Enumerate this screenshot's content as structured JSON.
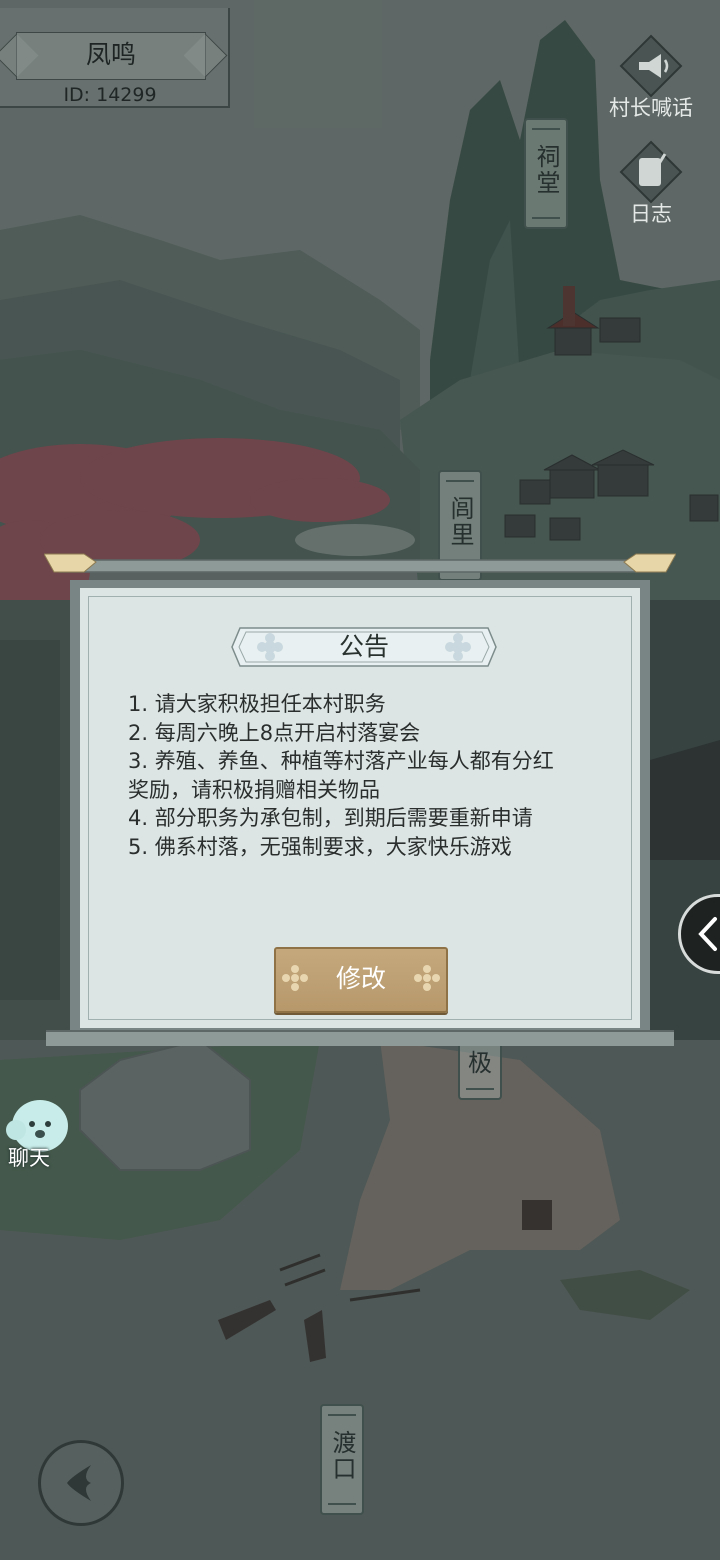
{
  "player": {
    "name": "凤鸣",
    "id_text": "ID: 14299"
  },
  "tools": [
    {
      "label": "村长喊话",
      "icon": "megaphone-icon"
    },
    {
      "label": "日志",
      "icon": "scroll-quill-icon"
    }
  ],
  "map_signs": {
    "ancestral_hall": "祠堂",
    "village_lane": "闾里",
    "ferry": "渡口",
    "partial_sign": "极"
  },
  "announcement": {
    "title": "公告",
    "items": [
      "1. 请大家积极担任本村职务",
      "2. 每周六晚上8点开启村落宴会",
      "3. 养殖、养鱼、种植等村落产业每人都有分红奖励，请积极捐赠相关物品",
      "4. 部分职务为承包制，到期后需要重新申请",
      "5. 佛系村落，无强制要求，大家快乐游戏"
    ],
    "edit_button": "修改"
  },
  "chat": {
    "label": "聊天"
  },
  "colors": {
    "button_gold": "#c5a97d",
    "panel_bg": "#dde5e4",
    "panel_frame": "#788584"
  }
}
